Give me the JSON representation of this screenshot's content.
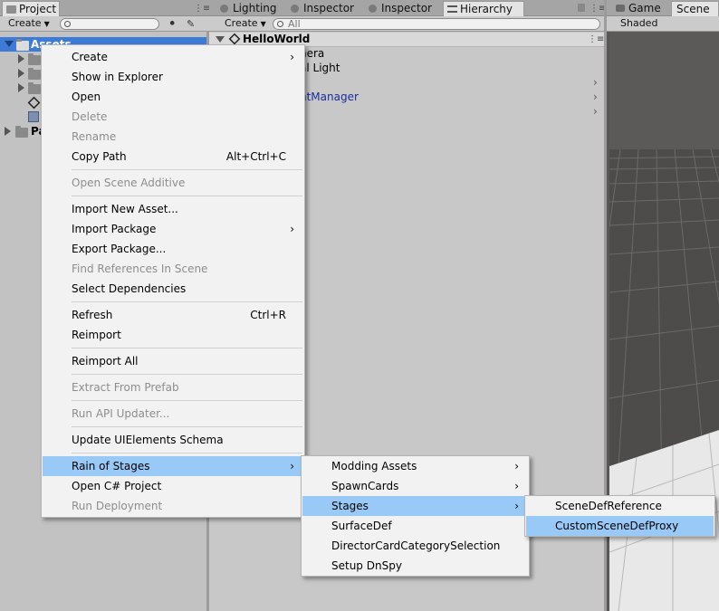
{
  "project_panel": {
    "tab_label": "Project",
    "create_label": "Create",
    "assets_label": "Assets",
    "packages_label": "Pa"
  },
  "hierarchy_panel": {
    "tabs": [
      "Lighting",
      "Inspector",
      "Inspector",
      "Hierarchy"
    ],
    "create_label": "Create",
    "search_placeholder": "All",
    "scene_name": "HelloWorld",
    "items": [
      "nera",
      "al Light",
      "ntManager"
    ]
  },
  "scene_panel": {
    "tabs": [
      "Game",
      "Scene"
    ],
    "shading_mode": "Shaded"
  },
  "context_menu": {
    "items": [
      {
        "label": "Create",
        "submenu": true
      },
      {
        "label": "Show in Explorer"
      },
      {
        "label": "Open"
      },
      {
        "label": "Delete",
        "disabled": true
      },
      {
        "label": "Rename",
        "disabled": true
      },
      {
        "label": "Copy Path",
        "shortcut": "Alt+Ctrl+C"
      },
      {
        "label": "Open Scene Additive",
        "disabled": true
      },
      {
        "label": "Import New Asset..."
      },
      {
        "label": "Import Package",
        "submenu": true
      },
      {
        "label": "Export Package..."
      },
      {
        "label": "Find References In Scene",
        "disabled": true
      },
      {
        "label": "Select Dependencies"
      },
      {
        "label": "Refresh",
        "shortcut": "Ctrl+R"
      },
      {
        "label": "Reimport"
      },
      {
        "label": "Reimport All"
      },
      {
        "label": "Extract From Prefab",
        "disabled": true
      },
      {
        "label": "Run API Updater...",
        "disabled": true
      },
      {
        "label": "Update UIElements Schema"
      },
      {
        "label": "Rain of Stages",
        "submenu": true,
        "highlighted": true
      },
      {
        "label": "Open C# Project"
      },
      {
        "label": "Run Deployment",
        "disabled": true
      }
    ]
  },
  "rain_of_stages_menu": {
    "items": [
      {
        "label": "Modding Assets",
        "submenu": true
      },
      {
        "label": "SpawnCards",
        "submenu": true
      },
      {
        "label": "Stages",
        "submenu": true,
        "highlighted": true
      },
      {
        "label": "SurfaceDef"
      },
      {
        "label": "DirectorCardCategorySelection"
      },
      {
        "label": "Setup DnSpy"
      }
    ]
  },
  "stages_menu": {
    "items": [
      {
        "label": "SceneDefReference"
      },
      {
        "label": "CustomSceneDefProxy",
        "highlighted": true
      }
    ]
  },
  "colors": {
    "highlight": "#99c9f7",
    "selection": "#3d7bd6",
    "hierarchy_prefab_text": "#1c2c9c"
  }
}
